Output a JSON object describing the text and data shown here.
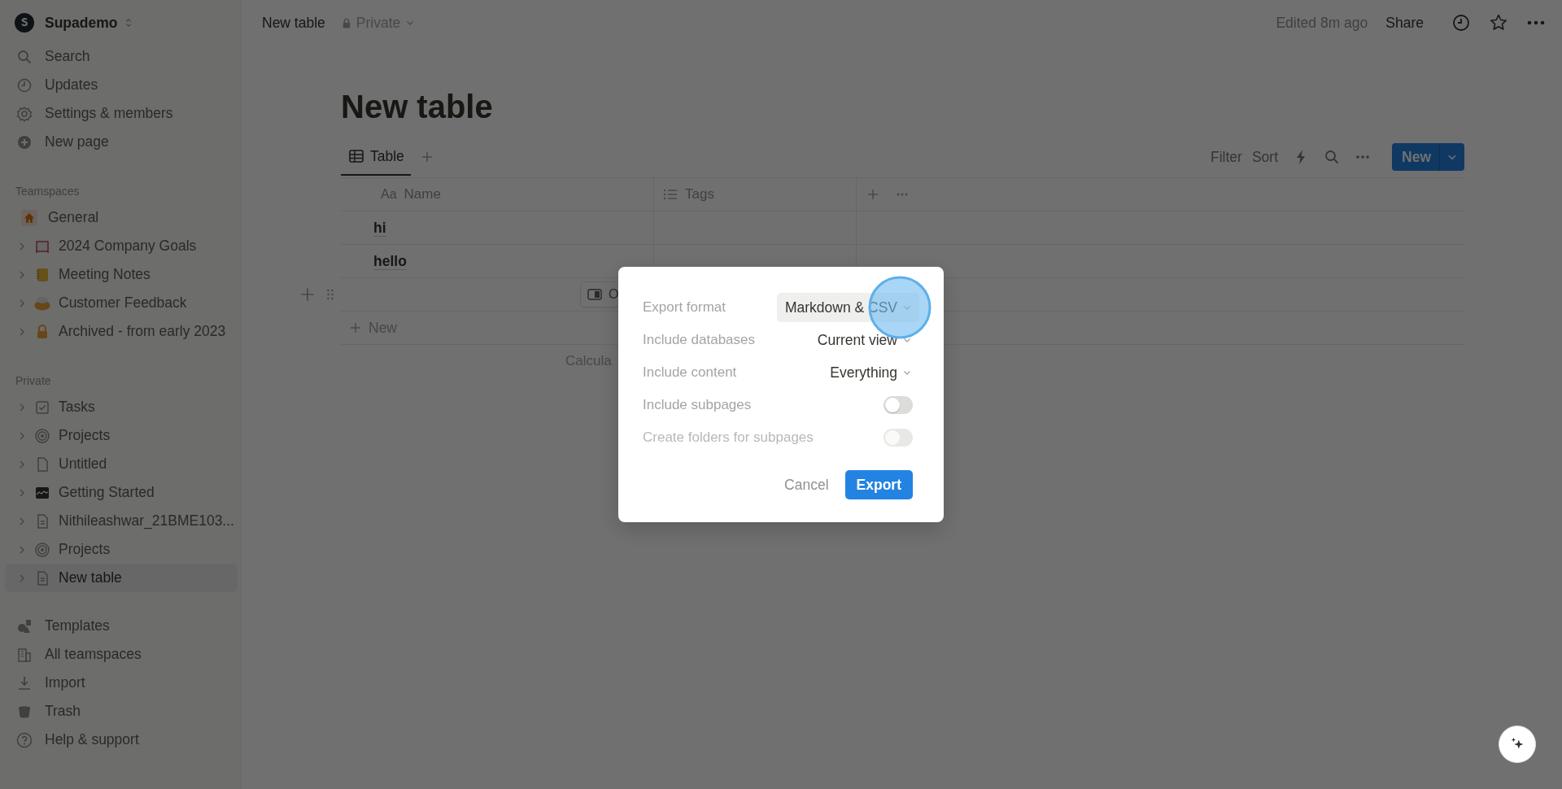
{
  "workspace": {
    "name": "Supademo"
  },
  "sidebar": {
    "top_items": [
      {
        "label": "Search"
      },
      {
        "label": "Updates"
      },
      {
        "label": "Settings & members"
      },
      {
        "label": "New page"
      }
    ],
    "sections": [
      {
        "title": "Teamspaces",
        "items": [
          {
            "label": "General",
            "expandable": false,
            "selected": false
          },
          {
            "label": "2024 Company Goals",
            "expandable": true,
            "selected": false
          },
          {
            "label": "Meeting Notes",
            "expandable": true,
            "selected": false
          },
          {
            "label": "Customer Feedback",
            "expandable": true,
            "selected": false
          },
          {
            "label": "Archived - from early 2023",
            "expandable": true,
            "selected": false
          }
        ]
      },
      {
        "title": "Private",
        "items": [
          {
            "label": "Tasks",
            "expandable": true,
            "selected": false
          },
          {
            "label": "Projects",
            "expandable": true,
            "selected": false
          },
          {
            "label": "Untitled",
            "expandable": true,
            "selected": false
          },
          {
            "label": "Getting Started",
            "expandable": true,
            "selected": false
          },
          {
            "label": "Nithileashwar_21BME103...",
            "expandable": true,
            "selected": false
          },
          {
            "label": "Projects",
            "expandable": true,
            "selected": false
          },
          {
            "label": "New table",
            "expandable": true,
            "selected": true
          }
        ]
      }
    ],
    "bottom_items": [
      {
        "label": "Templates"
      },
      {
        "label": "All teamspaces"
      },
      {
        "label": "Import"
      },
      {
        "label": "Trash"
      },
      {
        "label": "Help & support"
      }
    ]
  },
  "topbar": {
    "breadcrumb": "New table",
    "privacy": "Private",
    "edited": "Edited 8m ago",
    "share": "Share"
  },
  "page": {
    "title": "New table",
    "views": [
      {
        "label": "Table",
        "selected": true
      }
    ],
    "toolbar": {
      "filter": "Filter",
      "sort": "Sort",
      "new_button": "New"
    }
  },
  "table": {
    "columns": [
      {
        "label": "Name",
        "type_label": "Aa"
      },
      {
        "label": "Tags"
      }
    ],
    "rows": [
      {
        "name": "hi"
      },
      {
        "name": "hello"
      }
    ],
    "open_chip": "O",
    "add_row": "New",
    "calculate": "Calcula"
  },
  "dialog": {
    "rows": [
      {
        "kind": "select",
        "label": "Export format",
        "value": "Markdown & CSV",
        "highlighted": true
      },
      {
        "kind": "select",
        "label": "Include databases",
        "value": "Current view",
        "highlighted": false
      },
      {
        "kind": "select",
        "label": "Include content",
        "value": "Everything",
        "highlighted": false
      },
      {
        "kind": "toggle",
        "label": "Include subpages",
        "on": false,
        "disabled": false
      },
      {
        "kind": "toggle",
        "label": "Create folders for subpages",
        "on": false,
        "disabled": true
      }
    ],
    "cancel": "Cancel",
    "confirm": "Export"
  }
}
